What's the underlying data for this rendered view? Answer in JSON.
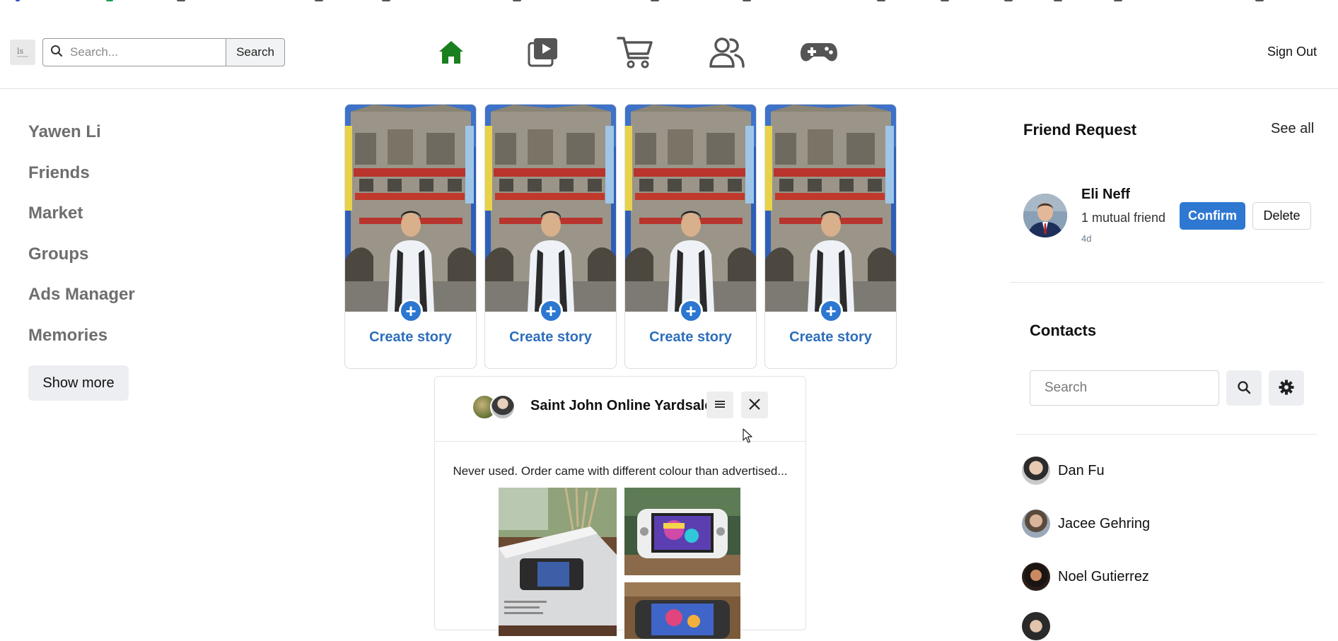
{
  "header": {
    "search": {
      "placeholder": "Search...",
      "button_label": "Search"
    },
    "nav_icons": [
      "home-icon",
      "video-icon",
      "cart-icon",
      "people-icon",
      "gamepad-icon"
    ],
    "active_nav": "home-icon",
    "sign_out_label": "Sign Out"
  },
  "sidebar": {
    "items": [
      {
        "label": "Yawen Li"
      },
      {
        "label": "Friends"
      },
      {
        "label": "Market"
      },
      {
        "label": "Groups"
      },
      {
        "label": "Ads Manager"
      },
      {
        "label": "Memories"
      }
    ],
    "show_more_label": "Show more"
  },
  "stories": [
    {
      "label": "Create story"
    },
    {
      "label": "Create story"
    },
    {
      "label": "Create story"
    },
    {
      "label": "Create story"
    }
  ],
  "post": {
    "group_name": "Saint John Online Yardsale",
    "text": "Never used. Order came with different colour than advertised..."
  },
  "friend_request": {
    "title": "Friend Request",
    "see_all_label": "See all",
    "request": {
      "name": "Eli Neff",
      "mutual": "1 mutual friend",
      "time": "4d",
      "confirm_label": "Confirm",
      "delete_label": "Delete"
    }
  },
  "contacts": {
    "title": "Contacts",
    "search_placeholder": "Search",
    "items": [
      {
        "name": "Dan Fu"
      },
      {
        "name": "Jacee Gehring"
      },
      {
        "name": "Noel Gutierrez"
      }
    ]
  },
  "colors": {
    "accent": "#2e78d2",
    "active_nav": "#1a7f1e",
    "sidebar_text": "#6e6e6e"
  }
}
